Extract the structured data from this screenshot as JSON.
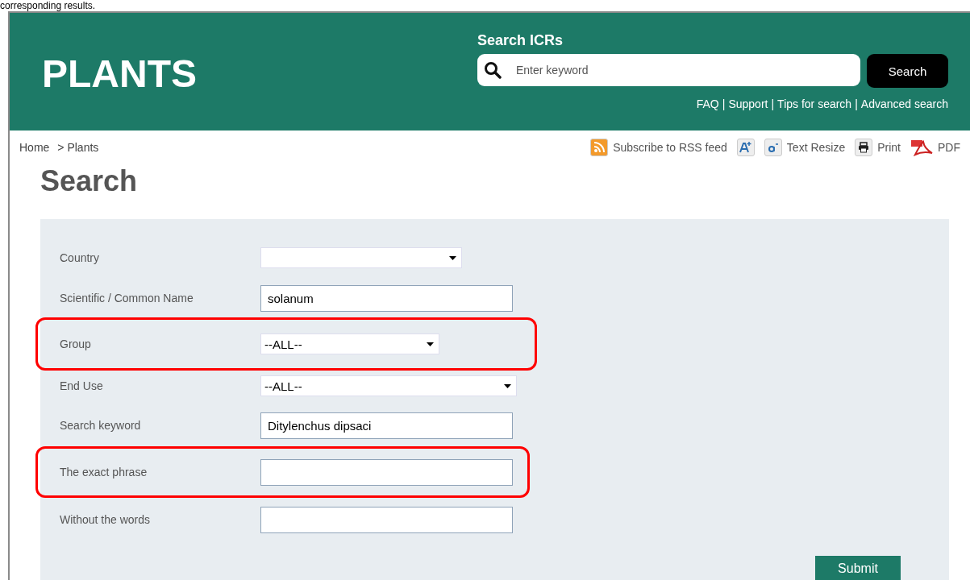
{
  "caption": "corresponding results.",
  "header": {
    "logo": "PLANTS",
    "search_title": "Search ICRs",
    "search_placeholder": "Enter keyword",
    "search_button": "Search",
    "links": [
      "FAQ",
      "Support",
      "Tips for search",
      "Advanced search"
    ],
    "separator": "|"
  },
  "breadcrumb": [
    "Home",
    "> Plants"
  ],
  "tools": [
    {
      "kind": "rss",
      "label": "Subscribe to RSS feed"
    },
    {
      "kind": "bigger"
    },
    {
      "kind": "smaller",
      "label": "Text Resize"
    },
    {
      "kind": "print",
      "label": "Print"
    },
    {
      "kind": "pdf",
      "label": "PDF"
    }
  ],
  "page_title": "Search",
  "form": {
    "fields": [
      {
        "label": "Country",
        "kind": "select",
        "highlighted": false
      },
      {
        "label": "Scientific / Common Name",
        "kind": "text",
        "value": "solanum",
        "highlighted": false
      },
      {
        "label": "Group",
        "kind": "select",
        "value": "--ALL--",
        "highlighted": true
      },
      {
        "label": "End Use",
        "kind": "select",
        "value": "--ALL--",
        "highlighted": false
      },
      {
        "label": "Search keyword",
        "kind": "text",
        "value": "Ditylenchus dipsaci",
        "highlighted": false
      },
      {
        "label": "The exact phrase",
        "kind": "text",
        "highlighted": true
      },
      {
        "label": "Without the words",
        "kind": "text",
        "highlighted": false
      }
    ],
    "submit": "Submit"
  }
}
